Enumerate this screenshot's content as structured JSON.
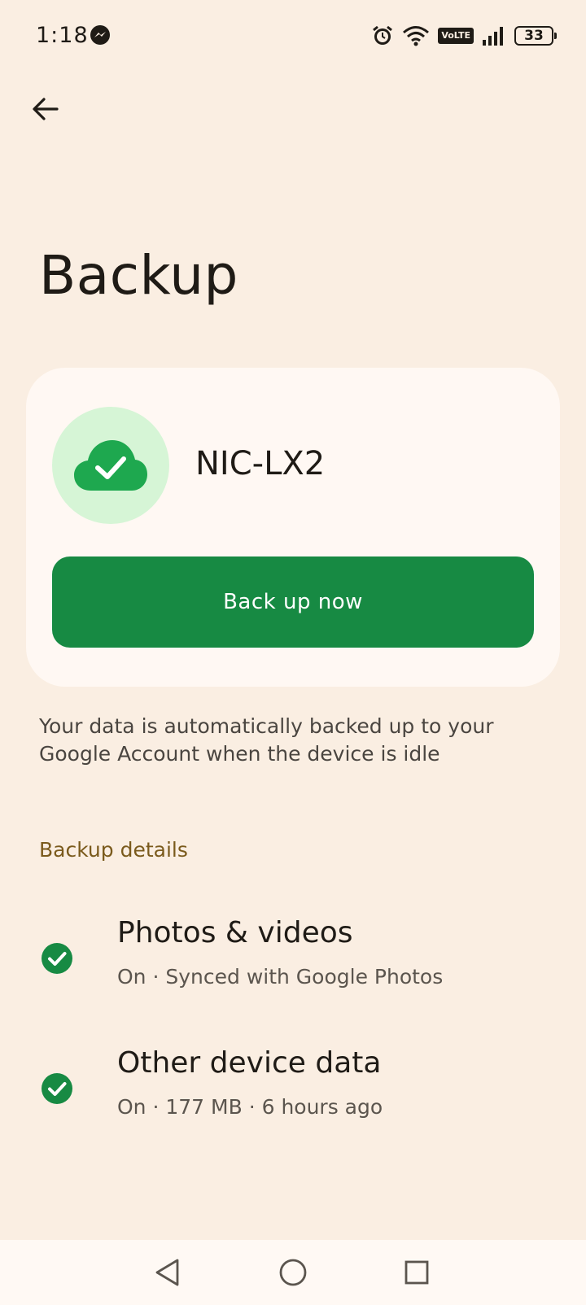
{
  "status_bar": {
    "time": "1:18",
    "battery_level": "33",
    "network_badge": "VoLTE",
    "icons": [
      "messenger-icon",
      "alarm-icon",
      "wifi-icon",
      "volte-icon",
      "signal-icon",
      "battery-icon"
    ]
  },
  "header": {
    "title": "Backup"
  },
  "card": {
    "device_name": "NIC-LX2",
    "backup_button_label": "Back up now",
    "icon": "cloud-check-icon"
  },
  "description": "Your data is automatically backed up to your Google Account when the device is idle",
  "details": {
    "section_label": "Backup details",
    "items": [
      {
        "title": "Photos & videos",
        "subtitle": "On · Synced with Google Photos",
        "icon": "check-circle-icon"
      },
      {
        "title": "Other device data",
        "subtitle": "On · 177 MB · 6 hours ago",
        "icon": "check-circle-icon"
      }
    ]
  },
  "navigation": {
    "icons": [
      "nav-back-icon",
      "nav-home-icon",
      "nav-recents-icon"
    ]
  },
  "colors": {
    "background": "#faeee2",
    "card": "#fff8f3",
    "accent_green": "#178a43",
    "cloud_circle": "#d6f5d6",
    "section_header": "#7a5a1c"
  }
}
